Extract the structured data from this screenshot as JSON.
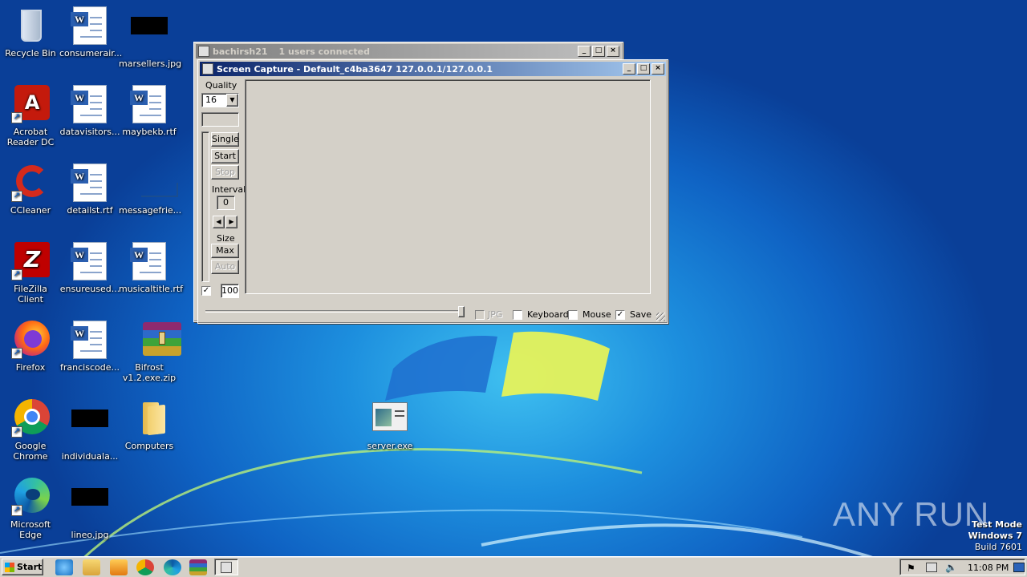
{
  "desktop": {
    "icons": [
      {
        "label": "Recycle Bin"
      },
      {
        "label": "consumerair..."
      },
      {
        "label": "marsellers.jpg"
      },
      {
        "label": "Acrobat Reader DC"
      },
      {
        "label": "datavisitors..."
      },
      {
        "label": "maybekb.rtf"
      },
      {
        "label": "CCleaner"
      },
      {
        "label": "detailst.rtf"
      },
      {
        "label": "messagefrie..."
      },
      {
        "label": "FileZilla Client"
      },
      {
        "label": "ensureused..."
      },
      {
        "label": "musicaltitle.rtf"
      },
      {
        "label": "Firefox"
      },
      {
        "label": "franciscode..."
      },
      {
        "label": "Bifrost v1.2.exe.zip"
      },
      {
        "label": "Google Chrome"
      },
      {
        "label": "individuala..."
      },
      {
        "label": "Computers"
      },
      {
        "label": "server.exe"
      },
      {
        "label": "Microsoft Edge"
      },
      {
        "label": "lineo.jpg"
      }
    ],
    "watermark": {
      "brand": "ANY RUN",
      "line1": "Test Mode",
      "line2": "Windows 7",
      "line3": "Build 7601"
    }
  },
  "back_window": {
    "title": "bachirsh21",
    "status": "1 users connected"
  },
  "capture_window": {
    "title": "Screen Capture - Default_c4ba3647 127.0.0.1/127.0.0.1",
    "quality_label": "Quality",
    "quality_value": "16",
    "single_label": "Single",
    "start_label": "Start",
    "stop_label": "Stop",
    "interval_label": "Interval",
    "interval_value": "0",
    "size_label": "Size",
    "max_label": "Max",
    "auto_label": "Auto",
    "percent_value": "100",
    "jpg_label": "JPG",
    "keyboard_label": "Keyboard",
    "mouse_label": "Mouse",
    "save_label": "Save",
    "checkbox_checked_mark": "✓",
    "checks": {
      "left": true,
      "jpg": false,
      "keyboard": false,
      "mouse": false,
      "save": true
    }
  },
  "taskbar": {
    "start_label": "Start",
    "clock": "11:08 PM"
  },
  "colors": {
    "titlebar_active": "#0a246a",
    "face": "#d4d0c8"
  }
}
